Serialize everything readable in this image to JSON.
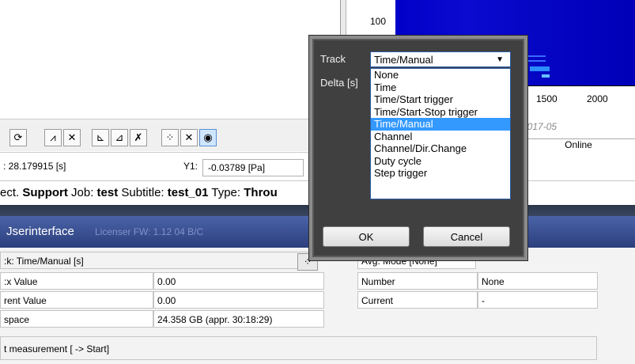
{
  "spectrogram": {
    "y_tick": "100",
    "x_ticks": [
      "1500",
      "2000"
    ],
    "date_label": "2017-05",
    "status_label": "Online"
  },
  "cursor": {
    "x_value": ": 28.179915 [s]",
    "y_label": "Y1:",
    "y_value": "-0.03789 [Pa]"
  },
  "project": {
    "prefix": "ect. ",
    "project_name": "Support",
    "job_label": " Job: ",
    "job_name": "test",
    "subtitle_label": " Subtitle: ",
    "subtitle_name": "test_01",
    "type_label": " Type: ",
    "type_name": "Throu"
  },
  "userinterface": {
    "title": "Jserinterface",
    "faint_text": "Licenser  FW: 1.12  04 B/C"
  },
  "lower": {
    "track_label": ":k: Time/Manual [s]",
    "rows": [
      {
        "label": ":x Value",
        "value": "0.00"
      },
      {
        "label": "rent Value",
        "value": "0.00"
      },
      {
        "label": " space",
        "value": "24.358 GB (appr. 30:18:29)"
      }
    ],
    "avg_mode": "Avg. Mode [None]",
    "right_rows": [
      {
        "label": "Number",
        "value": "None"
      },
      {
        "label": "Current",
        "value": "-"
      }
    ],
    "start_text": "t measurement [ -> Start]"
  },
  "dialog": {
    "track_label": "Track",
    "delta_label": "Delta [s]",
    "selected": "Time/Manual",
    "options": [
      "None",
      "Time",
      "Time/Start trigger",
      "Time/Start-Stop trigger",
      "Time/Manual",
      "Channel",
      "Channel/Dir.Change",
      "Duty cycle",
      "Step trigger"
    ],
    "ok_label": "OK",
    "cancel_label": "Cancel"
  }
}
